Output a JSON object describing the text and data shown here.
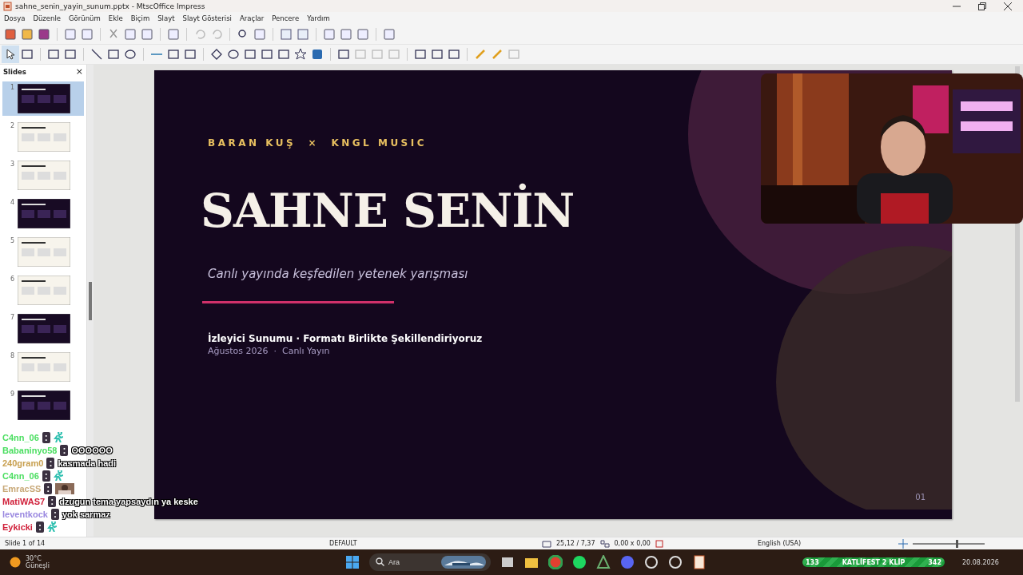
{
  "window": {
    "title": "sahne_senin_yayin_sunum.pptx - MtscOffice Impress"
  },
  "menu": [
    "Dosya",
    "Düzenle",
    "Görünüm",
    "Ekle",
    "Biçim",
    "Slayt",
    "Slayt Gösterisi",
    "Araçlar",
    "Pencere",
    "Yardım"
  ],
  "slides_panel": {
    "title": "Slides",
    "close": "×",
    "slides": [
      {
        "number": "1",
        "kind": "dark",
        "selected": true
      },
      {
        "number": "2",
        "kind": "light",
        "selected": false
      },
      {
        "number": "3",
        "kind": "light",
        "selected": false
      },
      {
        "number": "4",
        "kind": "dark",
        "selected": false
      },
      {
        "number": "5",
        "kind": "light",
        "selected": false
      },
      {
        "number": "6",
        "kind": "light",
        "selected": false
      },
      {
        "number": "7",
        "kind": "dark",
        "selected": false
      },
      {
        "number": "8",
        "kind": "light",
        "selected": false
      },
      {
        "number": "9",
        "kind": "dark",
        "selected": false
      }
    ]
  },
  "slide": {
    "kicker": "BARAN KUŞ  ×  KNGL MUSIC",
    "title": "SAHNE SENİN",
    "subtitle": "Canlı yayında keşfedilen yetenek yarışması",
    "audience": "İzleyici Sunumu · Formatı Birlikte Şekillendiriyoruz",
    "date": "Ağustos 2026  ·  Canlı Yayın",
    "page": "01"
  },
  "chat": [
    {
      "user": "C4nn_06",
      "color": "#4ade60",
      "sep": ":",
      "kind": "emote"
    },
    {
      "user": "Babaninyo58",
      "color": "#4ade60",
      "sep": ":",
      "kind": "text",
      "message": "OOOOOO"
    },
    {
      "user": "240gram0",
      "color": "#c8a050",
      "sep": ":",
      "kind": "text",
      "message": "kasmada hadi"
    },
    {
      "user": "C4nn_06",
      "color": "#4ade60",
      "sep": ":",
      "kind": "emote"
    },
    {
      "user": "EmracSS",
      "color": "#c8a878",
      "sep": ":"
    },
    {
      "user": "MatiWAS7",
      "color": "#d0203a",
      "sep": ":",
      "kind": "text",
      "message": "dzugun tema yapsaydın ya keske"
    },
    {
      "user": "leventkock",
      "color": "#9a88e0",
      "sep": ":",
      "kind": "text",
      "message": "yok sarmaz"
    },
    {
      "user": "Eykicki",
      "color": "#d0203a",
      "sep": ":",
      "kind": "emote"
    }
  ],
  "status_bar": {
    "slide": "Slide 1 of 14",
    "layout": "DEFAULT",
    "position": "25,12 / 7,37",
    "size": "0,00 x 0,00",
    "language": "English (USA)",
    "zoom": {
      "level": 0.6
    }
  },
  "taskbar": {
    "weather_temp": "30°C",
    "weather_text": "Güneşli",
    "search_placeholder": "Ara",
    "goal_start": "133",
    "goal_label": "KATLİFEST 2 KLİP",
    "goal_end": "342",
    "date": "20.08.2026"
  }
}
